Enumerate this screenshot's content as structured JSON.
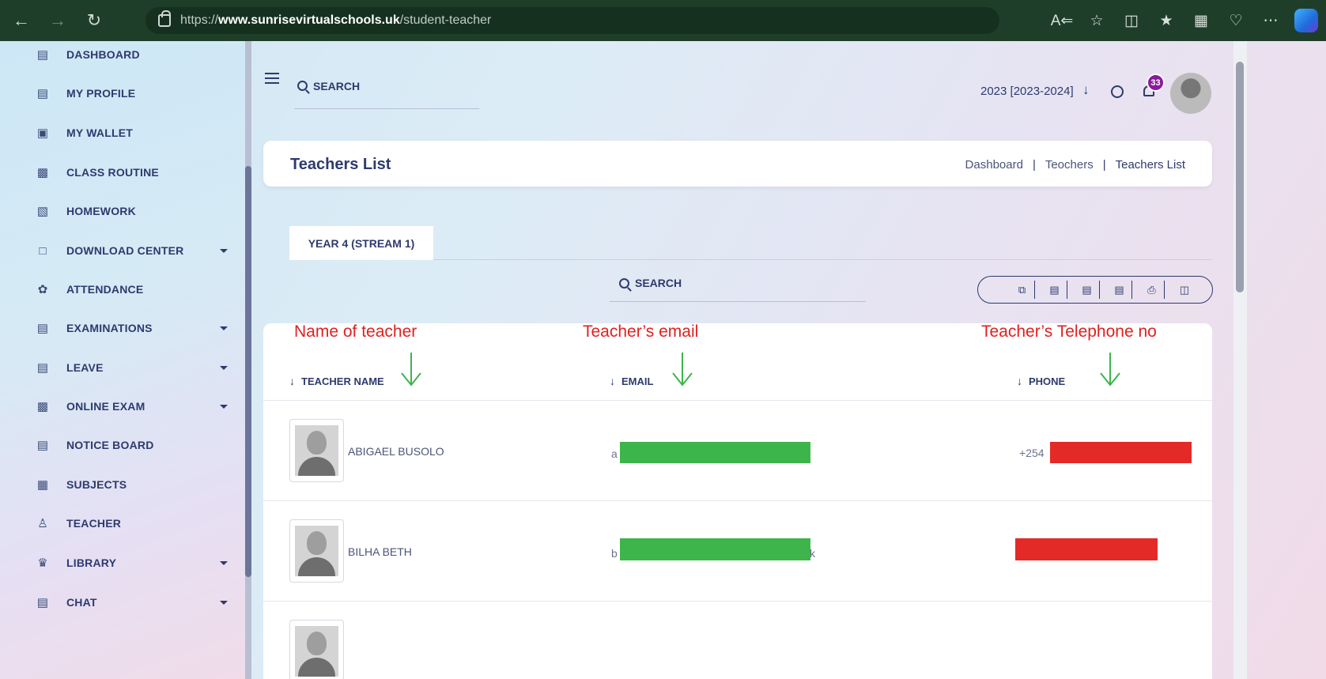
{
  "browser": {
    "url_prefix": "https://",
    "url_host": "www.sunrisevirtualschools.uk",
    "url_path": "/student-teacher"
  },
  "sidebar": {
    "items": [
      {
        "label": "DASHBOARD",
        "icon": "dashboard-icon",
        "caret": false
      },
      {
        "label": "MY PROFILE",
        "icon": "profile-icon",
        "caret": false
      },
      {
        "label": "MY WALLET",
        "icon": "wallet-icon",
        "caret": false
      },
      {
        "label": "CLASS ROUTINE",
        "icon": "routine-icon",
        "caret": false
      },
      {
        "label": "HOMEWORK",
        "icon": "homework-icon",
        "caret": false
      },
      {
        "label": "DOWNLOAD CENTER",
        "icon": "download-icon",
        "caret": true
      },
      {
        "label": "ATTENDANCE",
        "icon": "attendance-icon",
        "caret": false
      },
      {
        "label": "EXAMINATIONS",
        "icon": "exam-icon",
        "caret": true
      },
      {
        "label": "LEAVE",
        "icon": "leave-icon",
        "caret": true
      },
      {
        "label": "ONLINE EXAM",
        "icon": "online-exam-icon",
        "caret": true
      },
      {
        "label": "NOTICE BOARD",
        "icon": "notice-icon",
        "caret": false
      },
      {
        "label": "SUBJECTS",
        "icon": "subjects-icon",
        "caret": false
      },
      {
        "label": "TEACHER",
        "icon": "teacher-icon",
        "caret": false
      },
      {
        "label": "LIBRARY",
        "icon": "library-icon",
        "caret": true
      },
      {
        "label": "CHAT",
        "icon": "chat-icon",
        "caret": true
      }
    ]
  },
  "header": {
    "search_label": "SEARCH",
    "session": "2023 [2023-2024]",
    "notification_count": "33"
  },
  "title_card": {
    "title": "Teachers List",
    "breadcrumb": [
      "Dashboard",
      "Teochers",
      "Teachers List"
    ]
  },
  "tabs": [
    {
      "label": "YEAR 4 (STREAM 1)"
    }
  ],
  "table": {
    "search_label": "SEARCH",
    "annotations": {
      "name": "Name of teacher",
      "email": "Teacher’s email",
      "phone": "Teacher’s Telephone no"
    },
    "columns": {
      "name": "TEACHER NAME",
      "email": "EMAIL",
      "phone": "PHONE"
    },
    "rows": [
      {
        "name": "ABIGAEL BUSOLO",
        "email_visible": "a",
        "email_tail": "",
        "phone_visible": "+254"
      },
      {
        "name": "BILHA BETH",
        "email_visible": "b",
        "email_tail": "k",
        "phone_visible": ""
      }
    ]
  },
  "colors": {
    "brand_text": "#2e3a6e",
    "annotation_red": "#e02020",
    "annotation_green": "#3db54a",
    "redact_red": "#e32a26"
  }
}
